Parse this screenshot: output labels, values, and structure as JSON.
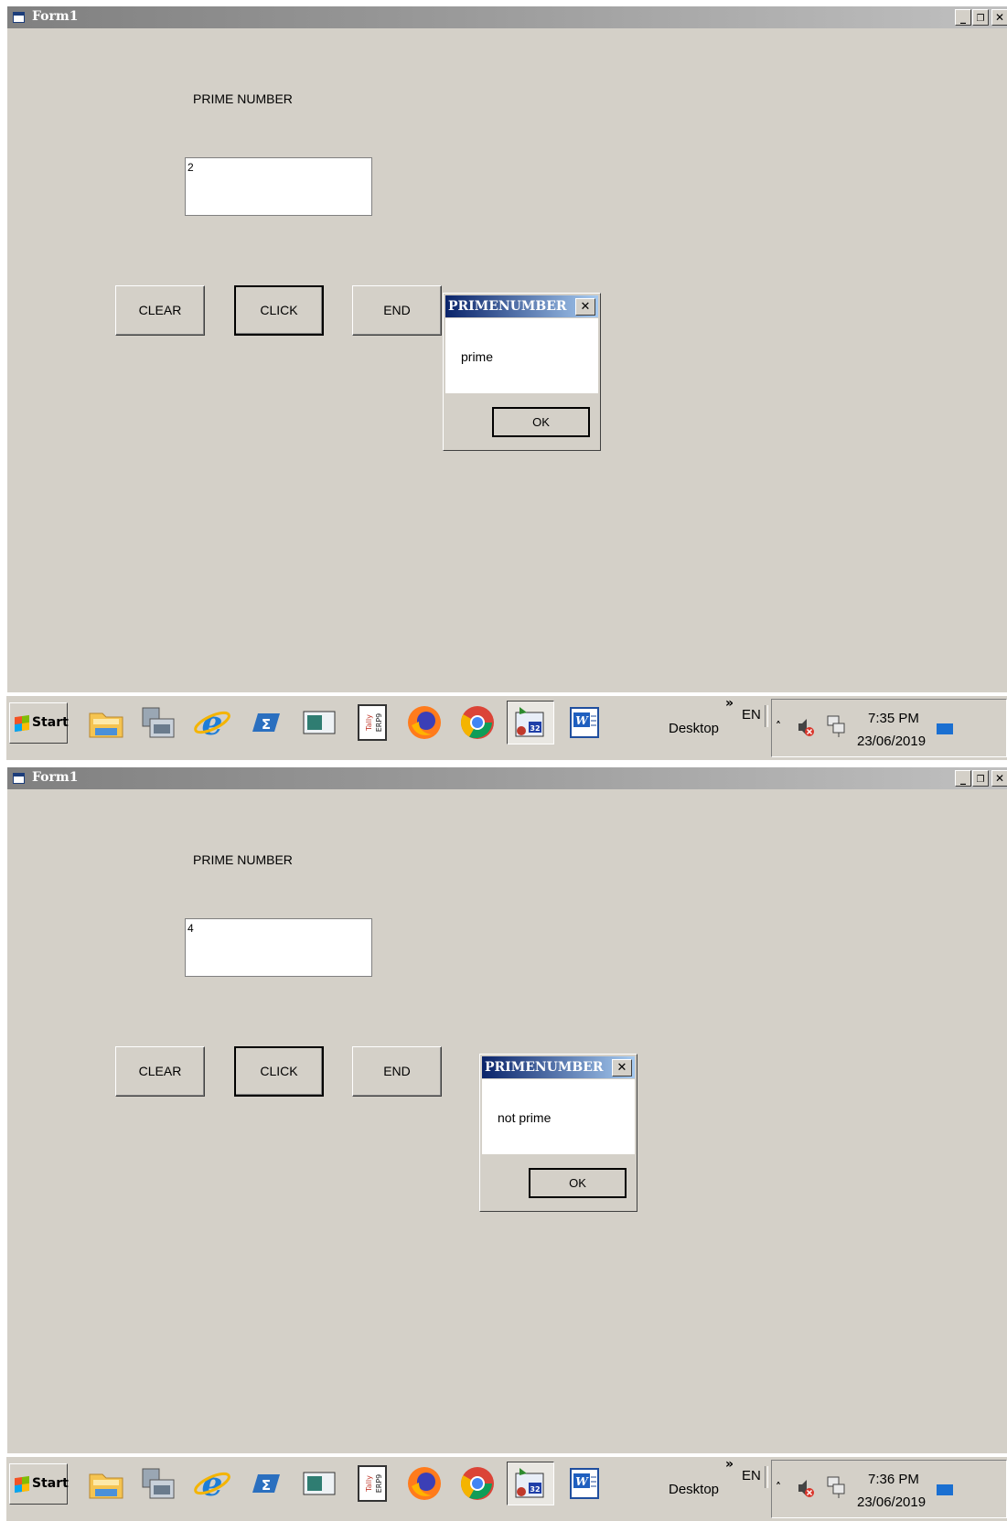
{
  "screens": [
    {
      "window_title": "Form1",
      "controls": {
        "minimize": "_",
        "restore": "🗗",
        "close": "✕"
      },
      "form": {
        "caption": "PRIME NUMBER",
        "input_value": "2",
        "clear_label": "CLEAR",
        "click_label": "CLICK",
        "end_label": "END"
      },
      "dialog": {
        "title": "PRIMENUMBER",
        "close": "✕",
        "message": "prime",
        "ok_label": "OK"
      },
      "taskbar": {
        "start_label": "Start",
        "desktop_label": "Desktop",
        "chevron": "»",
        "language": "EN",
        "tray_arrow": "˄",
        "time": "7:35 PM",
        "date": "23/06/2019",
        "icons": [
          "file-explorer-icon",
          "control-panel-icon",
          "internet-explorer-icon",
          "powershell-icon",
          "console-window-icon",
          "tally-erp9-icon",
          "firefox-icon",
          "chrome-icon",
          "vb6-app-icon",
          "word-icon"
        ],
        "tray_icons": [
          "volume-muted-icon",
          "network-icon"
        ]
      }
    },
    {
      "window_title": "Form1",
      "controls": {
        "minimize": "_",
        "restore": "🗗",
        "close": "✕"
      },
      "form": {
        "caption": "PRIME NUMBER",
        "input_value": "4",
        "clear_label": "CLEAR",
        "click_label": "CLICK",
        "end_label": "END"
      },
      "dialog": {
        "title": "PRIMENUMBER",
        "close": "✕",
        "message": "not prime",
        "ok_label": "OK"
      },
      "taskbar": {
        "start_label": "Start",
        "desktop_label": "Desktop",
        "chevron": "»",
        "language": "EN",
        "tray_arrow": "˄",
        "time": "7:36 PM",
        "date": "23/06/2019",
        "icons": [
          "file-explorer-icon",
          "control-panel-icon",
          "internet-explorer-icon",
          "powershell-icon",
          "console-window-icon",
          "tally-erp9-icon",
          "firefox-icon",
          "chrome-icon",
          "vb6-app-icon",
          "word-icon"
        ],
        "tray_icons": [
          "volume-muted-icon",
          "network-icon"
        ]
      }
    }
  ]
}
